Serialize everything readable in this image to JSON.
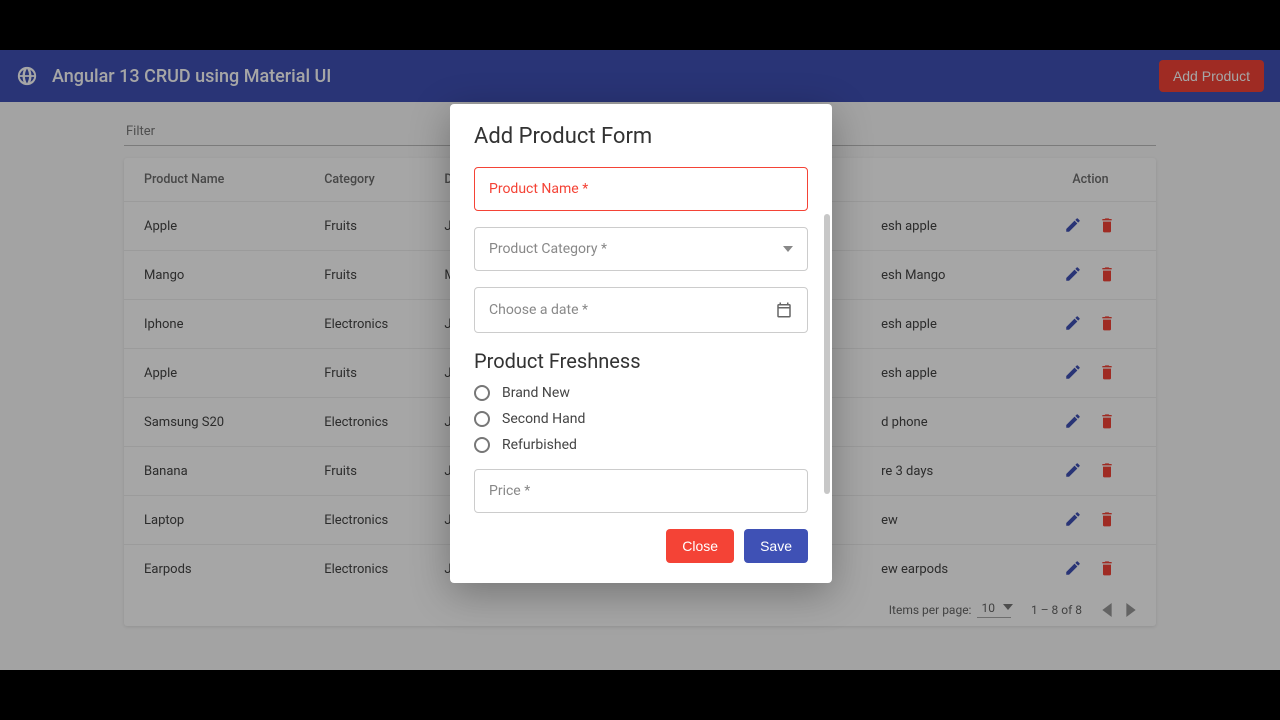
{
  "toolbar": {
    "title": "Angular 13 CRUD using Material UI",
    "add_button": "Add Product"
  },
  "filter": {
    "label": "Filter"
  },
  "table": {
    "columns": {
      "name": "Product Name",
      "category": "Category",
      "date": "Date",
      "comment": "",
      "action": "Action"
    },
    "rows": [
      {
        "name": "Apple",
        "category": "Fruits",
        "date_prefix": "Ja",
        "comment_suffix": "esh apple"
      },
      {
        "name": "Mango",
        "category": "Fruits",
        "date_prefix": "Ma",
        "comment_suffix": "esh Mango"
      },
      {
        "name": "Iphone",
        "category": "Electronics",
        "date_prefix": "Ja",
        "comment_suffix": "esh apple"
      },
      {
        "name": "Apple",
        "category": "Fruits",
        "date_prefix": "Ja",
        "comment_suffix": "esh apple"
      },
      {
        "name": "Samsung S20",
        "category": "Electronics",
        "date_prefix": "Ja",
        "comment_suffix": "d phone"
      },
      {
        "name": "Banana",
        "category": "Fruits",
        "date_prefix": "Ja",
        "comment_suffix": "re 3 days"
      },
      {
        "name": "Laptop",
        "category": "Electronics",
        "date_prefix": "Ja",
        "comment_suffix": "ew"
      },
      {
        "name": "Earpods",
        "category": "Electronics",
        "date_prefix": "Ja",
        "comment_suffix": "ew earpods"
      }
    ]
  },
  "paginator": {
    "items_label": "Items per page:",
    "page_size": "10",
    "range": "1 – 8 of 8"
  },
  "dialog": {
    "title": "Add Product Form",
    "product_name_label": "Product Name *",
    "product_category_label": "Product Category *",
    "date_label": "Choose a date *",
    "freshness_title": "Product Freshness",
    "freshness_options": [
      "Brand New",
      "Second Hand",
      "Refurbished"
    ],
    "price_label": "Price *",
    "close_button": "Close",
    "save_button": "Save"
  },
  "colors": {
    "primary": "#3f51b5",
    "accent": "#f44336"
  }
}
